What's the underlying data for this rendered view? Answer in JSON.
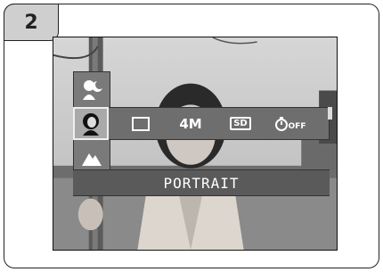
{
  "step_number": "2",
  "menu": {
    "label": "PORTRAIT",
    "icons": [
      {
        "name": "portrait-mode-icon",
        "selected": true
      },
      {
        "name": "single-frame-icon"
      },
      {
        "name": "image-size-4m-icon",
        "text": "4M"
      },
      {
        "name": "sd-card-icon",
        "text": "SD"
      },
      {
        "name": "self-timer-off-icon",
        "text": "OFF"
      }
    ],
    "column_icons": [
      {
        "name": "night-portrait-icon"
      },
      {
        "name": "landscape-mode-icon"
      }
    ]
  }
}
